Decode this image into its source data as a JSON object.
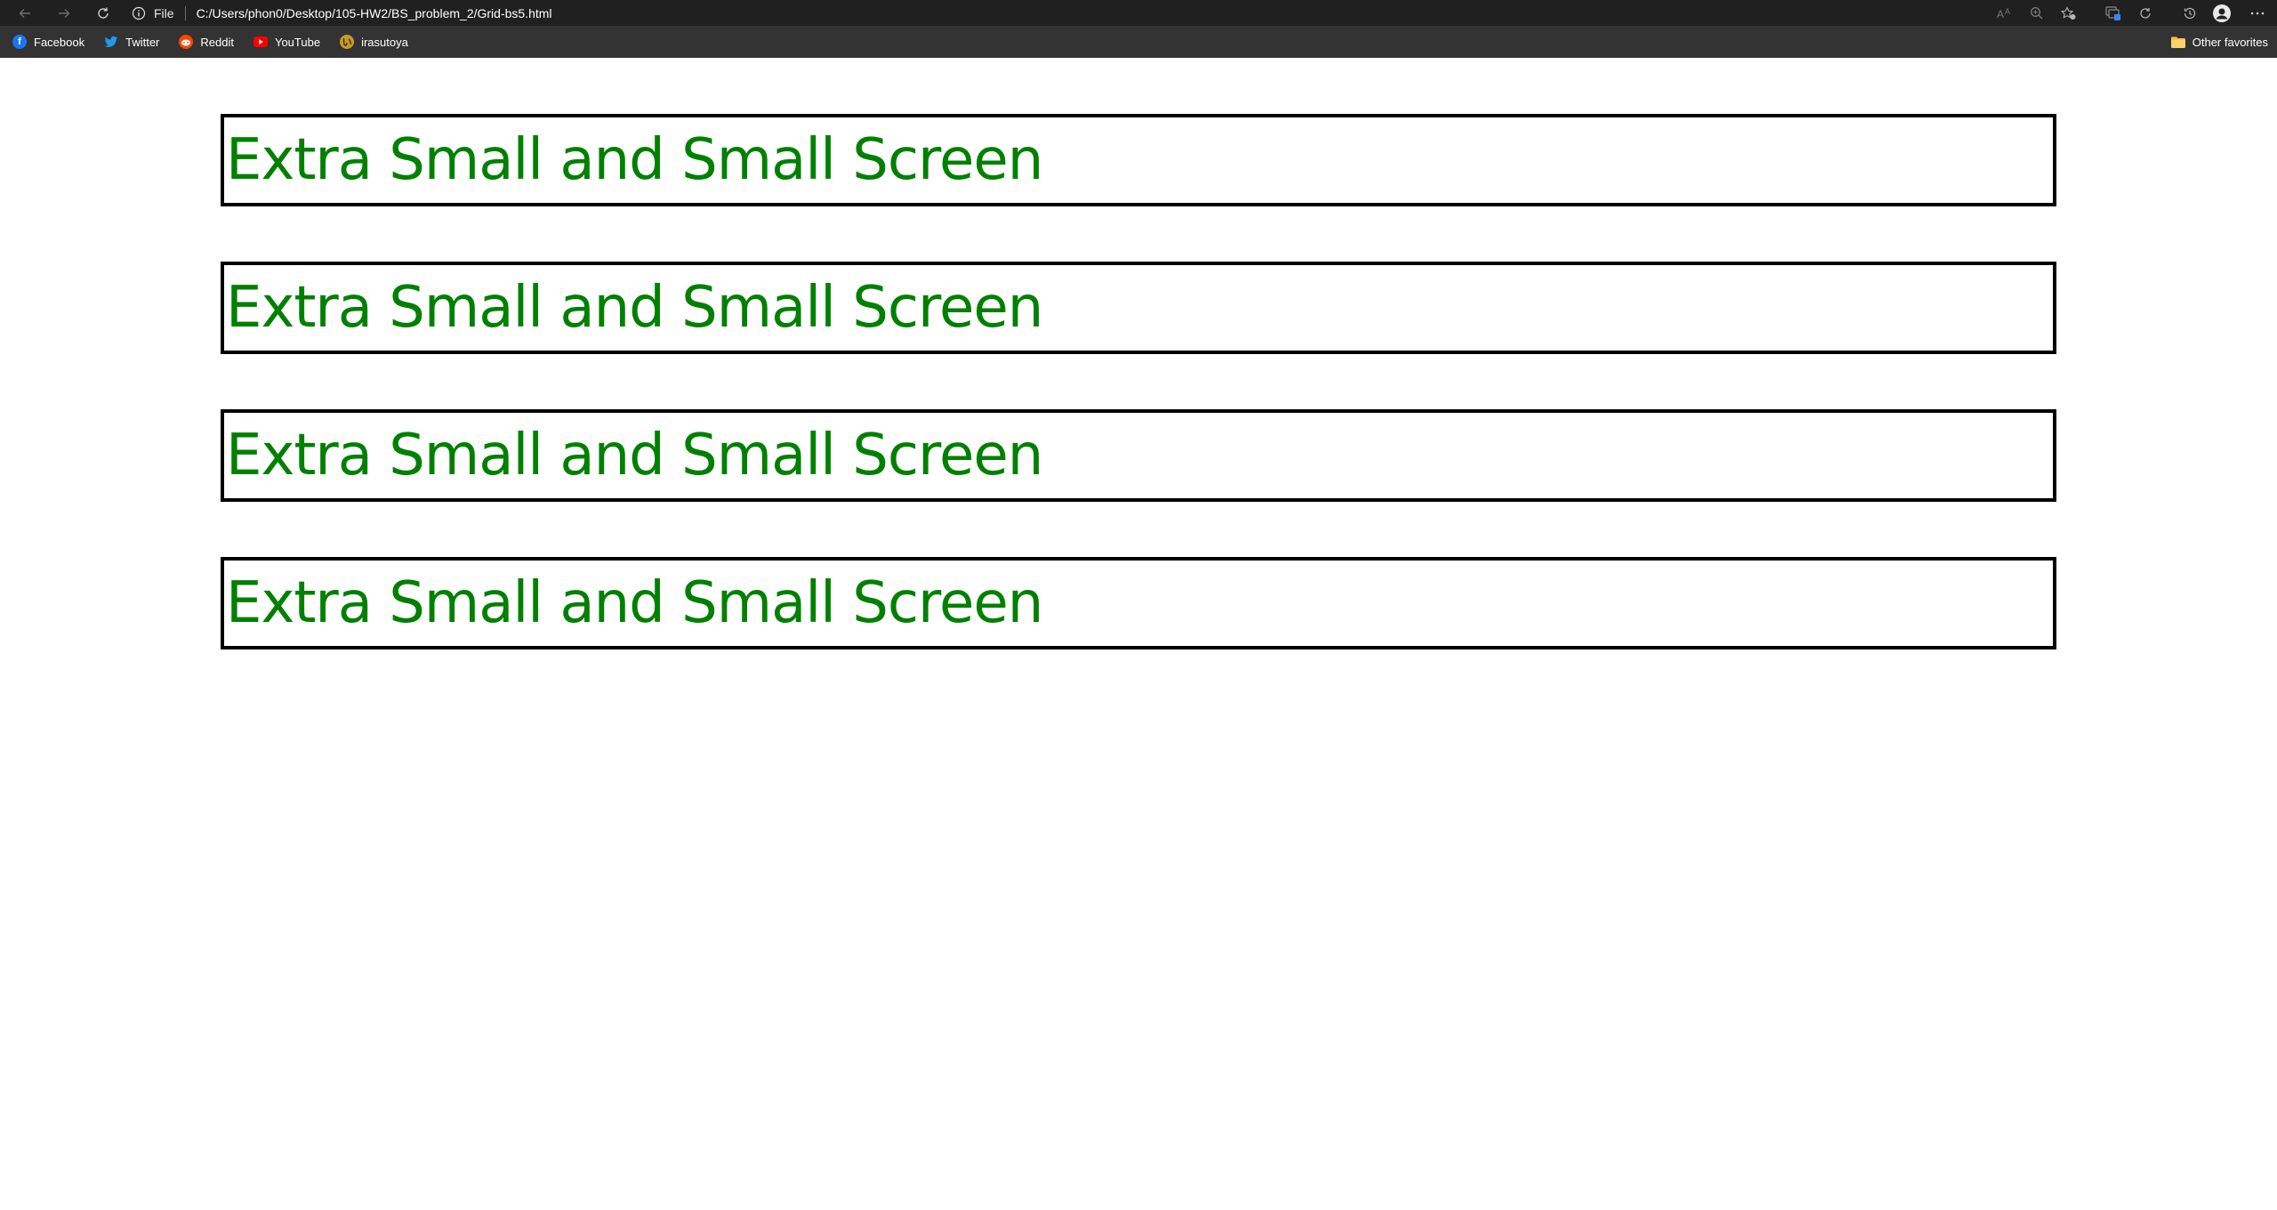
{
  "browser": {
    "address": {
      "scheme_label": "File",
      "url": "C:/Users/phon0/Desktop/105-HW2/BS_problem_2/Grid-bs5.html"
    },
    "bookmarks": [
      {
        "label": "Facebook",
        "icon": "facebook-icon",
        "color": "#1877f2"
      },
      {
        "label": "Twitter",
        "icon": "twitter-icon",
        "color": "#1d9bf0"
      },
      {
        "label": "Reddit",
        "icon": "reddit-icon",
        "color": "#ff4500"
      },
      {
        "label": "YouTube",
        "icon": "youtube-icon",
        "color": "#ff0000"
      },
      {
        "label": "irasutoya",
        "icon": "irasutoya-icon",
        "color": "#c89a2e"
      }
    ],
    "other_favorites": "Other favorites"
  },
  "content": {
    "text_color": "#008000",
    "boxes": [
      {
        "text": "Extra Small and Small Screen"
      },
      {
        "text": "Extra Small and Small Screen"
      },
      {
        "text": "Extra Small and Small Screen"
      },
      {
        "text": "Extra Small and Small Screen"
      }
    ]
  }
}
